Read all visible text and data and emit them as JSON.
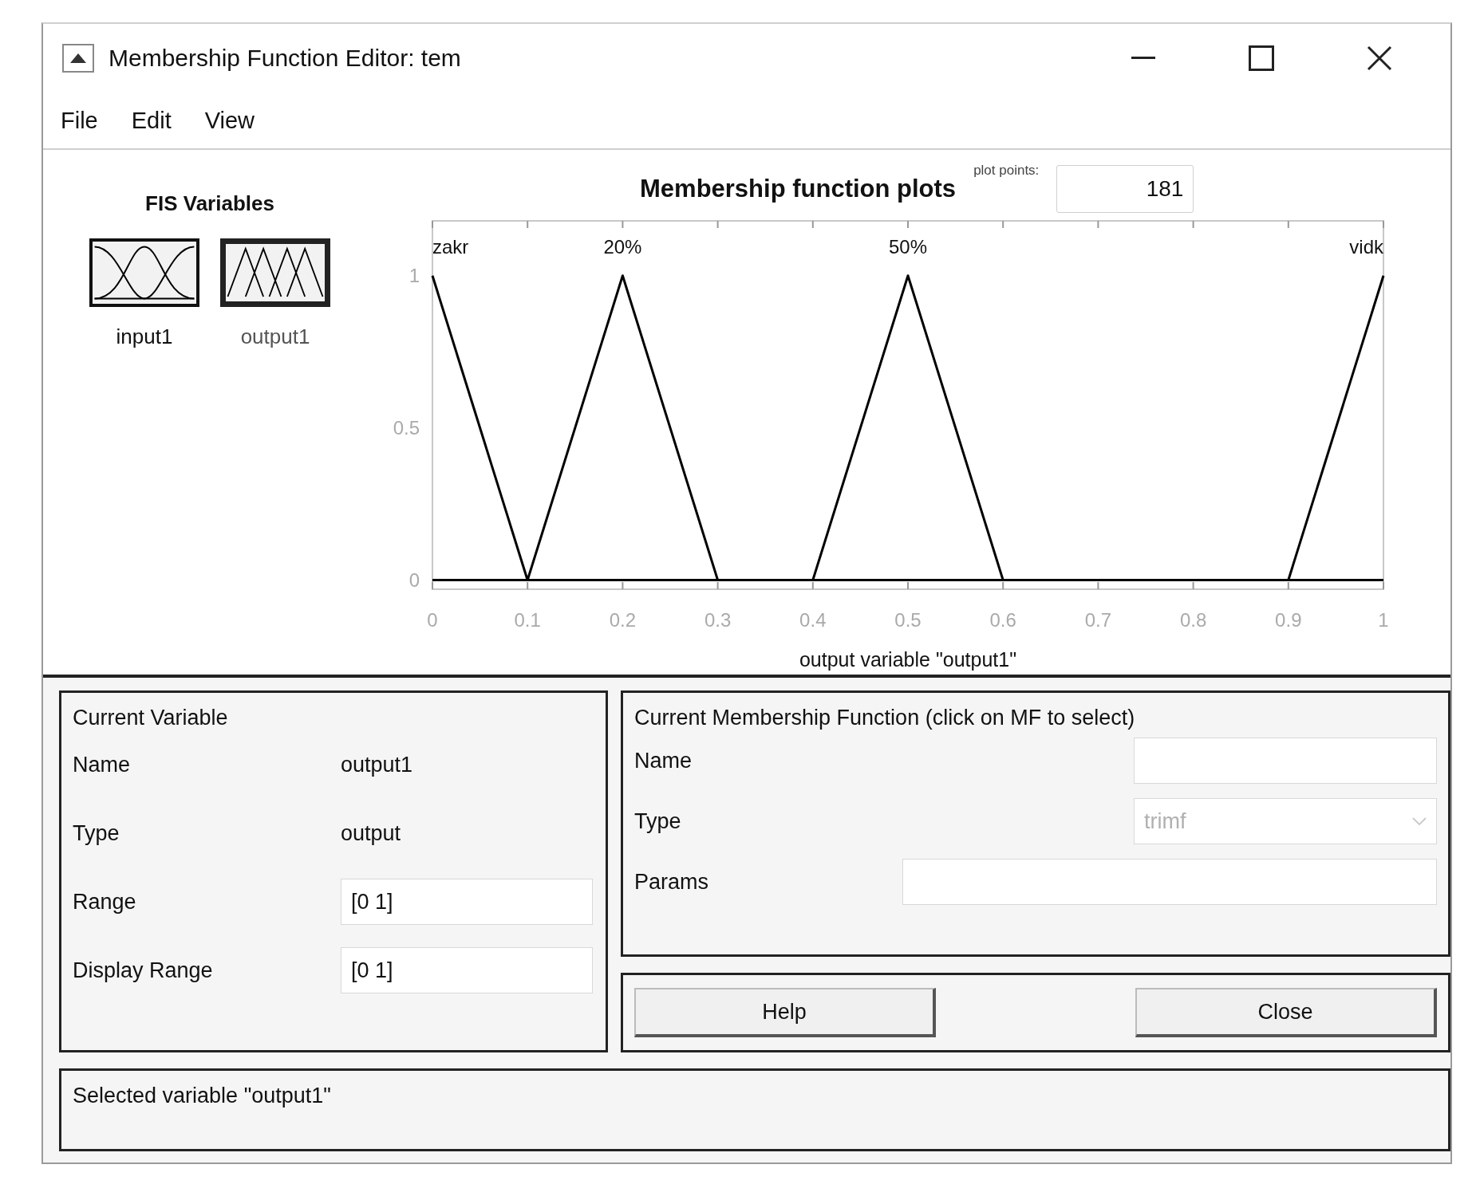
{
  "window": {
    "title": "Membership Function Editor: tem"
  },
  "menu": [
    "File",
    "Edit",
    "View"
  ],
  "fis_variables": {
    "heading": "FIS Variables",
    "items": [
      {
        "label": "input1",
        "kind": "input",
        "selected": false
      },
      {
        "label": "output1",
        "kind": "output",
        "selected": true
      }
    ]
  },
  "plot": {
    "plot_points_label": "plot points:",
    "plot_points": "181",
    "chart_data": {
      "type": "line",
      "title": "Membership function plots",
      "xlabel": "output variable \"output1\"",
      "x": [
        0,
        0.1,
        0.2,
        0.3,
        0.4,
        0.5,
        0.6,
        0.9,
        1
      ],
      "series": [
        {
          "name": "zakr",
          "color": "#000000",
          "values": [
            1,
            0,
            null,
            null,
            null,
            null,
            null,
            null,
            null
          ]
        },
        {
          "name": "20%",
          "color": "#000000",
          "values": [
            null,
            0,
            1,
            0,
            null,
            null,
            null,
            null,
            null
          ]
        },
        {
          "name": "50%",
          "color": "#000000",
          "values": [
            null,
            null,
            null,
            null,
            0,
            1,
            0,
            null,
            null
          ]
        },
        {
          "name": "vidk",
          "color": "#000000",
          "values": [
            null,
            null,
            null,
            null,
            null,
            null,
            null,
            0,
            1
          ]
        }
      ],
      "xlim": [
        0,
        1
      ],
      "ylim": [
        -0.03,
        1.18
      ],
      "xticks": [
        0,
        0.1,
        0.2,
        0.3,
        0.4,
        0.5,
        0.6,
        0.7,
        0.8,
        0.9,
        1
      ],
      "yticks": [
        0,
        0.5,
        1
      ]
    }
  },
  "current_variable": {
    "heading": "Current Variable",
    "rows": [
      {
        "label": "Name",
        "kind": "text",
        "value": "output1"
      },
      {
        "label": "Type",
        "kind": "text",
        "value": "output"
      },
      {
        "label": "Range",
        "kind": "field",
        "value": "[0 1]"
      },
      {
        "label": "Display Range",
        "kind": "field",
        "value": "[0 1]"
      }
    ]
  },
  "current_mf": {
    "heading": "Current Membership Function (click on MF to select)",
    "rows": [
      {
        "label": "Name",
        "kind": "field"
      },
      {
        "label": "Type",
        "kind": "select",
        "value": "trimf",
        "disabled": true
      },
      {
        "label": "Params",
        "kind": "wide_field"
      }
    ]
  },
  "buttons": [
    "Help",
    "Close"
  ],
  "status": "Selected variable \"output1\""
}
